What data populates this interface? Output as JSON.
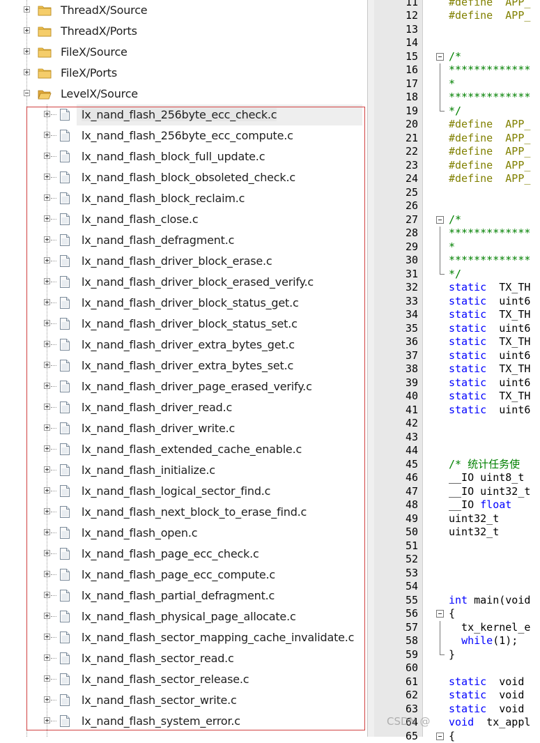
{
  "project_tree": {
    "groups": [
      {
        "label": "ThreadX/Source",
        "expanded": false
      },
      {
        "label": "ThreadX/Ports",
        "expanded": false
      },
      {
        "label": "FileX/Source",
        "expanded": false
      },
      {
        "label": "FileX/Ports",
        "expanded": false
      },
      {
        "label": "LevelX/Source",
        "expanded": true
      }
    ],
    "files": [
      "lx_nand_flash_256byte_ecc_check.c",
      "lx_nand_flash_256byte_ecc_compute.c",
      "lx_nand_flash_block_full_update.c",
      "lx_nand_flash_block_obsoleted_check.c",
      "lx_nand_flash_block_reclaim.c",
      "lx_nand_flash_close.c",
      "lx_nand_flash_defragment.c",
      "lx_nand_flash_driver_block_erase.c",
      "lx_nand_flash_driver_block_erased_verify.c",
      "lx_nand_flash_driver_block_status_get.c",
      "lx_nand_flash_driver_block_status_set.c",
      "lx_nand_flash_driver_extra_bytes_get.c",
      "lx_nand_flash_driver_extra_bytes_set.c",
      "lx_nand_flash_driver_page_erased_verify.c",
      "lx_nand_flash_driver_read.c",
      "lx_nand_flash_driver_write.c",
      "lx_nand_flash_extended_cache_enable.c",
      "lx_nand_flash_initialize.c",
      "lx_nand_flash_logical_sector_find.c",
      "lx_nand_flash_next_block_to_erase_find.c",
      "lx_nand_flash_open.c",
      "lx_nand_flash_page_ecc_check.c",
      "lx_nand_flash_page_ecc_compute.c",
      "lx_nand_flash_partial_defragment.c",
      "lx_nand_flash_physical_page_allocate.c",
      "lx_nand_flash_sector_mapping_cache_invalidate.c",
      "lx_nand_flash_sector_read.c",
      "lx_nand_flash_sector_release.c",
      "lx_nand_flash_sector_write.c",
      "lx_nand_flash_system_error.c"
    ],
    "selected_file": "lx_nand_flash_256byte_ecc_check.c"
  },
  "editor": {
    "lines": [
      {
        "n": "11",
        "t": "#define  APP_",
        "k": "pp"
      },
      {
        "n": "12",
        "t": "#define  APP_",
        "k": "pp"
      },
      {
        "n": "13",
        "t": "",
        "k": ""
      },
      {
        "n": "14",
        "t": "",
        "k": ""
      },
      {
        "n": "15",
        "t": "/*",
        "k": "cm",
        "fold": "open"
      },
      {
        "n": "16",
        "t": "*************",
        "k": "cm",
        "fold": "line"
      },
      {
        "n": "17",
        "t": "*",
        "k": "cm",
        "fold": "line"
      },
      {
        "n": "18",
        "t": "*************",
        "k": "cm",
        "fold": "line"
      },
      {
        "n": "19",
        "t": "*/",
        "k": "cm",
        "fold": "end"
      },
      {
        "n": "20",
        "t": "#define  APP_",
        "k": "pp"
      },
      {
        "n": "21",
        "t": "#define  APP_",
        "k": "pp"
      },
      {
        "n": "22",
        "t": "#define  APP_",
        "k": "pp"
      },
      {
        "n": "23",
        "t": "#define  APP_",
        "k": "pp"
      },
      {
        "n": "24",
        "t": "#define  APP_",
        "k": "pp"
      },
      {
        "n": "25",
        "t": "",
        "k": ""
      },
      {
        "n": "26",
        "t": "",
        "k": ""
      },
      {
        "n": "27",
        "t": "/*",
        "k": "cm",
        "fold": "open"
      },
      {
        "n": "28",
        "t": "*************",
        "k": "cm",
        "fold": "line"
      },
      {
        "n": "29",
        "t": "*",
        "k": "cm",
        "fold": "line"
      },
      {
        "n": "30",
        "t": "*************",
        "k": "cm",
        "fold": "line"
      },
      {
        "n": "31",
        "t": "*/",
        "k": "cm",
        "fold": "end"
      },
      {
        "n": "32",
        "kw": "static",
        "t": "  TX_TH",
        "k": "kw"
      },
      {
        "n": "33",
        "kw": "static",
        "t": "  uint6",
        "k": "kw"
      },
      {
        "n": "34",
        "kw": "static",
        "t": "  TX_TH",
        "k": "kw"
      },
      {
        "n": "35",
        "kw": "static",
        "t": "  uint6",
        "k": "kw"
      },
      {
        "n": "36",
        "kw": "static",
        "t": "  TX_TH",
        "k": "kw"
      },
      {
        "n": "37",
        "kw": "static",
        "t": "  uint6",
        "k": "kw"
      },
      {
        "n": "38",
        "kw": "static",
        "t": "  TX_TH",
        "k": "kw"
      },
      {
        "n": "39",
        "kw": "static",
        "t": "  uint6",
        "k": "kw"
      },
      {
        "n": "40",
        "kw": "static",
        "t": "  TX_TH",
        "k": "kw"
      },
      {
        "n": "41",
        "kw": "static",
        "t": "  uint6",
        "k": "kw"
      },
      {
        "n": "42",
        "t": "",
        "k": ""
      },
      {
        "n": "43",
        "t": "",
        "k": ""
      },
      {
        "n": "44",
        "t": "",
        "k": ""
      },
      {
        "n": "45",
        "t": "/* 统计任务使",
        "k": "cm"
      },
      {
        "n": "46",
        "t": "__IO uint8_t",
        "k": ""
      },
      {
        "n": "47",
        "t": "__IO uint32_t",
        "k": ""
      },
      {
        "n": "48",
        "pre": "__IO ",
        "kw": "float",
        "t": "",
        "k": "kw2"
      },
      {
        "n": "49",
        "t": "uint32_t",
        "k": ""
      },
      {
        "n": "50",
        "t": "uint32_t",
        "k": ""
      },
      {
        "n": "51",
        "t": "",
        "k": ""
      },
      {
        "n": "52",
        "t": "",
        "k": ""
      },
      {
        "n": "53",
        "t": "",
        "k": ""
      },
      {
        "n": "54",
        "t": "",
        "k": ""
      },
      {
        "n": "55",
        "kw": "int",
        "t": " main(void",
        "k": "kw"
      },
      {
        "n": "56",
        "t": "{",
        "k": "",
        "fold": "open"
      },
      {
        "n": "57",
        "t": "  tx_kernel_e",
        "k": "",
        "fold": "line"
      },
      {
        "n": "58",
        "pre": "  ",
        "kw": "while",
        "t": "(1);",
        "k": "kw2",
        "fold": "line"
      },
      {
        "n": "59",
        "t": "}",
        "k": "",
        "fold": "end"
      },
      {
        "n": "60",
        "t": "",
        "k": ""
      },
      {
        "n": "61",
        "kw": "static",
        "t": "  void",
        "k": "kw"
      },
      {
        "n": "62",
        "kw": "static",
        "t": "  void",
        "k": "kw"
      },
      {
        "n": "63",
        "kw": "static",
        "t": "  void",
        "k": "kw"
      },
      {
        "n": "64",
        "kw": "void",
        "t": "  tx_appl",
        "k": "kw"
      },
      {
        "n": "65",
        "t": "{",
        "k": "",
        "fold": "open"
      }
    ],
    "watermark": "CSDN @"
  }
}
